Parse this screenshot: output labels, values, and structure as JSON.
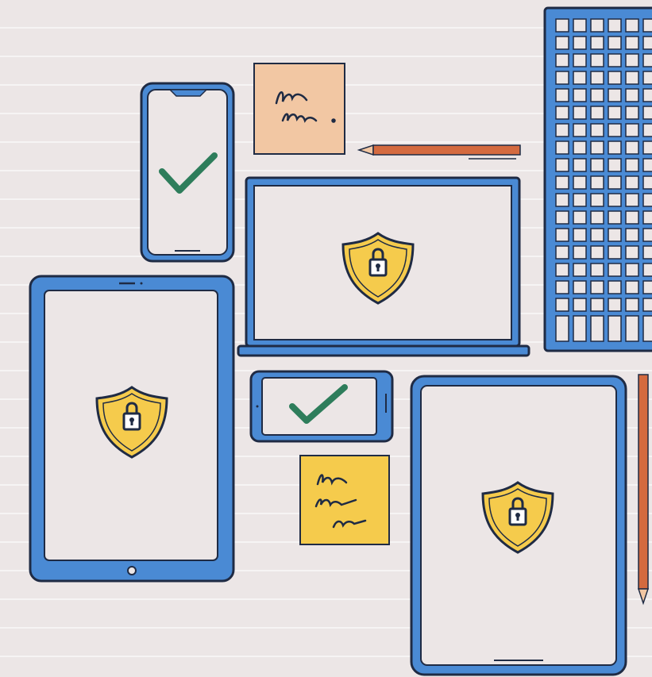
{
  "scene": {
    "colors": {
      "device_blue": "#4a8ad4",
      "outline": "#1f2b44",
      "screen_fill": "#ece6e6",
      "shield_yellow": "#f5cb4c",
      "check_green": "#2e7d5b",
      "note_peach": "#f2c7a3",
      "note_yellow": "#f5cb4c",
      "pencil_orange": "#d46a3f",
      "keyboard_key": "#ece6e6"
    },
    "icons": {
      "shield": "shield-lock-icon",
      "check": "checkmark-icon",
      "note_scribble": "handwritten-note-icon"
    }
  }
}
